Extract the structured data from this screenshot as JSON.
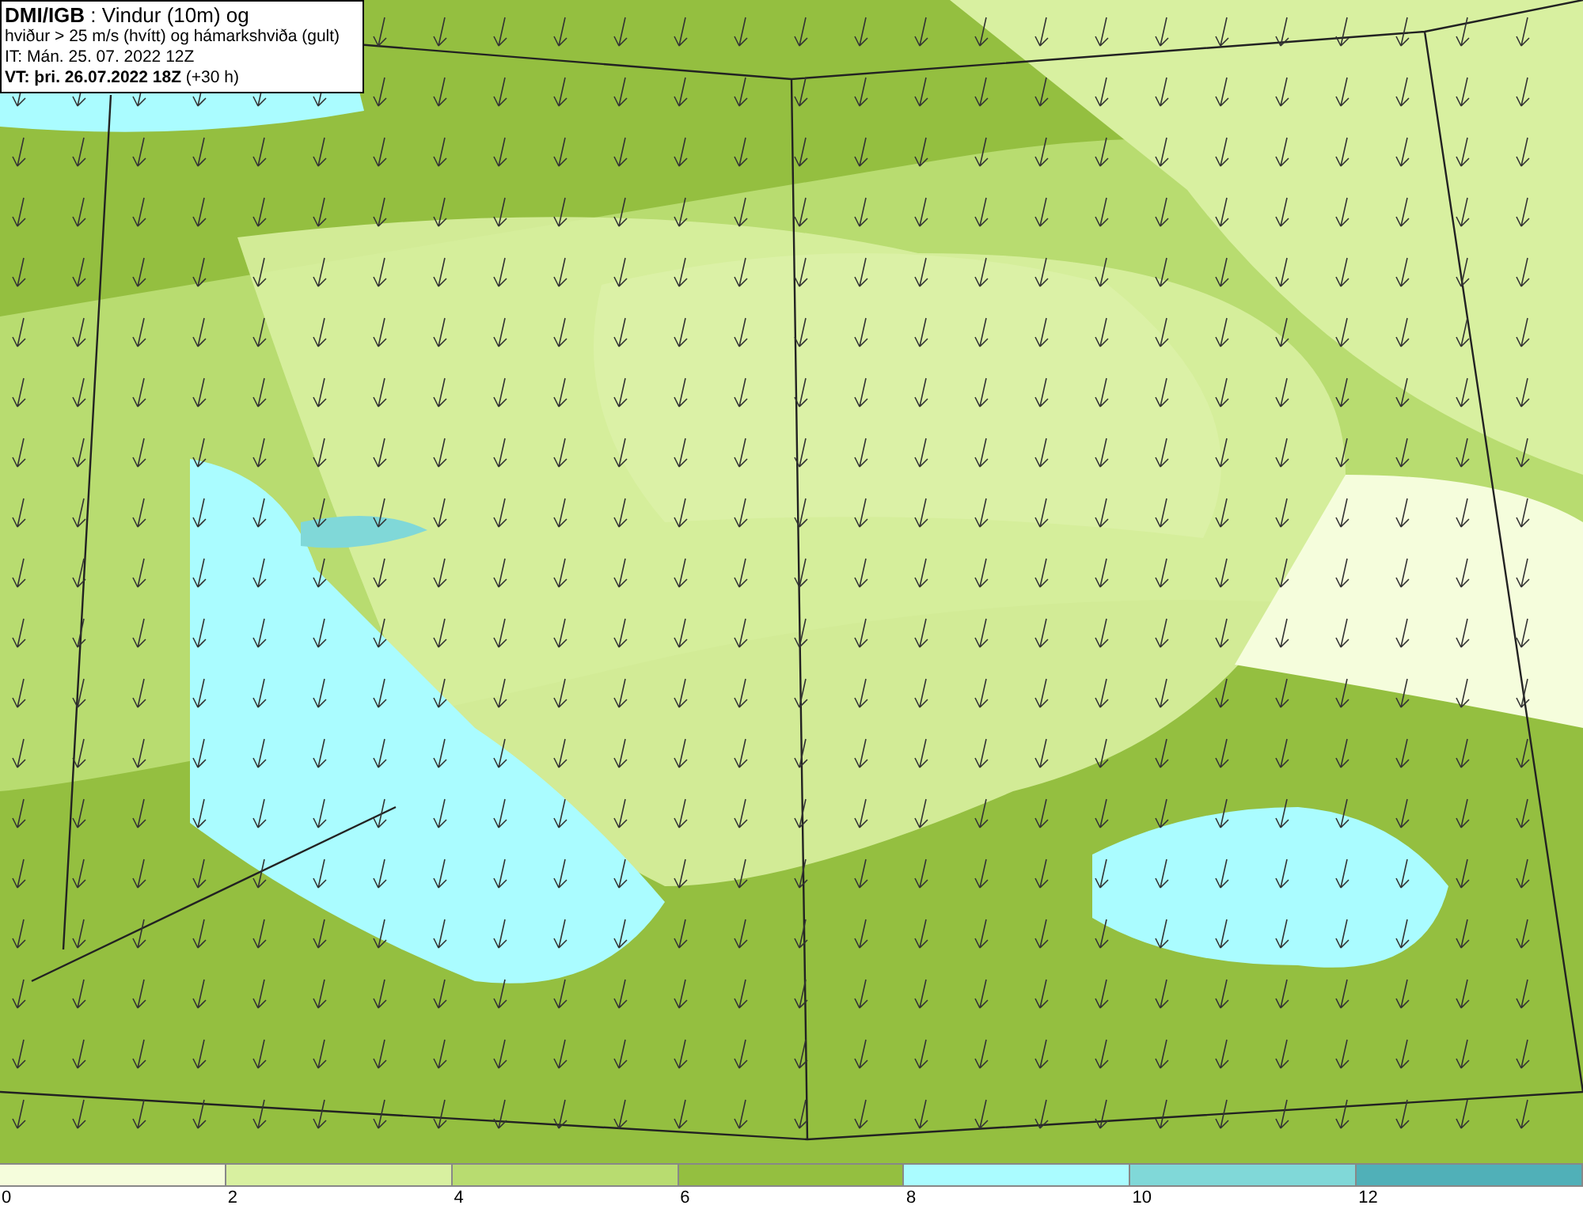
{
  "title_box": {
    "lines": [
      "**DMI/IGB** : Vindur (10m) og",
      "hviður > 25 m/s (hvítt) og hámarkshviða (gult)",
      "IT: Mán. 25. 07. 2022 12Z",
      "**VT: þri. 26.07.2022 18Z** (+30 h)"
    ]
  },
  "legend": {
    "bins": [
      {
        "color": "#f5fddc"
      },
      {
        "color": "#d8f0a0"
      },
      {
        "color": "#b8dc70"
      },
      {
        "color": "#94bf40"
      },
      {
        "color": "#aafcff"
      },
      {
        "color": "#80d8d8"
      },
      {
        "color": "#50b0b8"
      }
    ],
    "ticks": [
      "0",
      "2",
      "4",
      "6",
      "8",
      "10",
      "12"
    ]
  }
}
